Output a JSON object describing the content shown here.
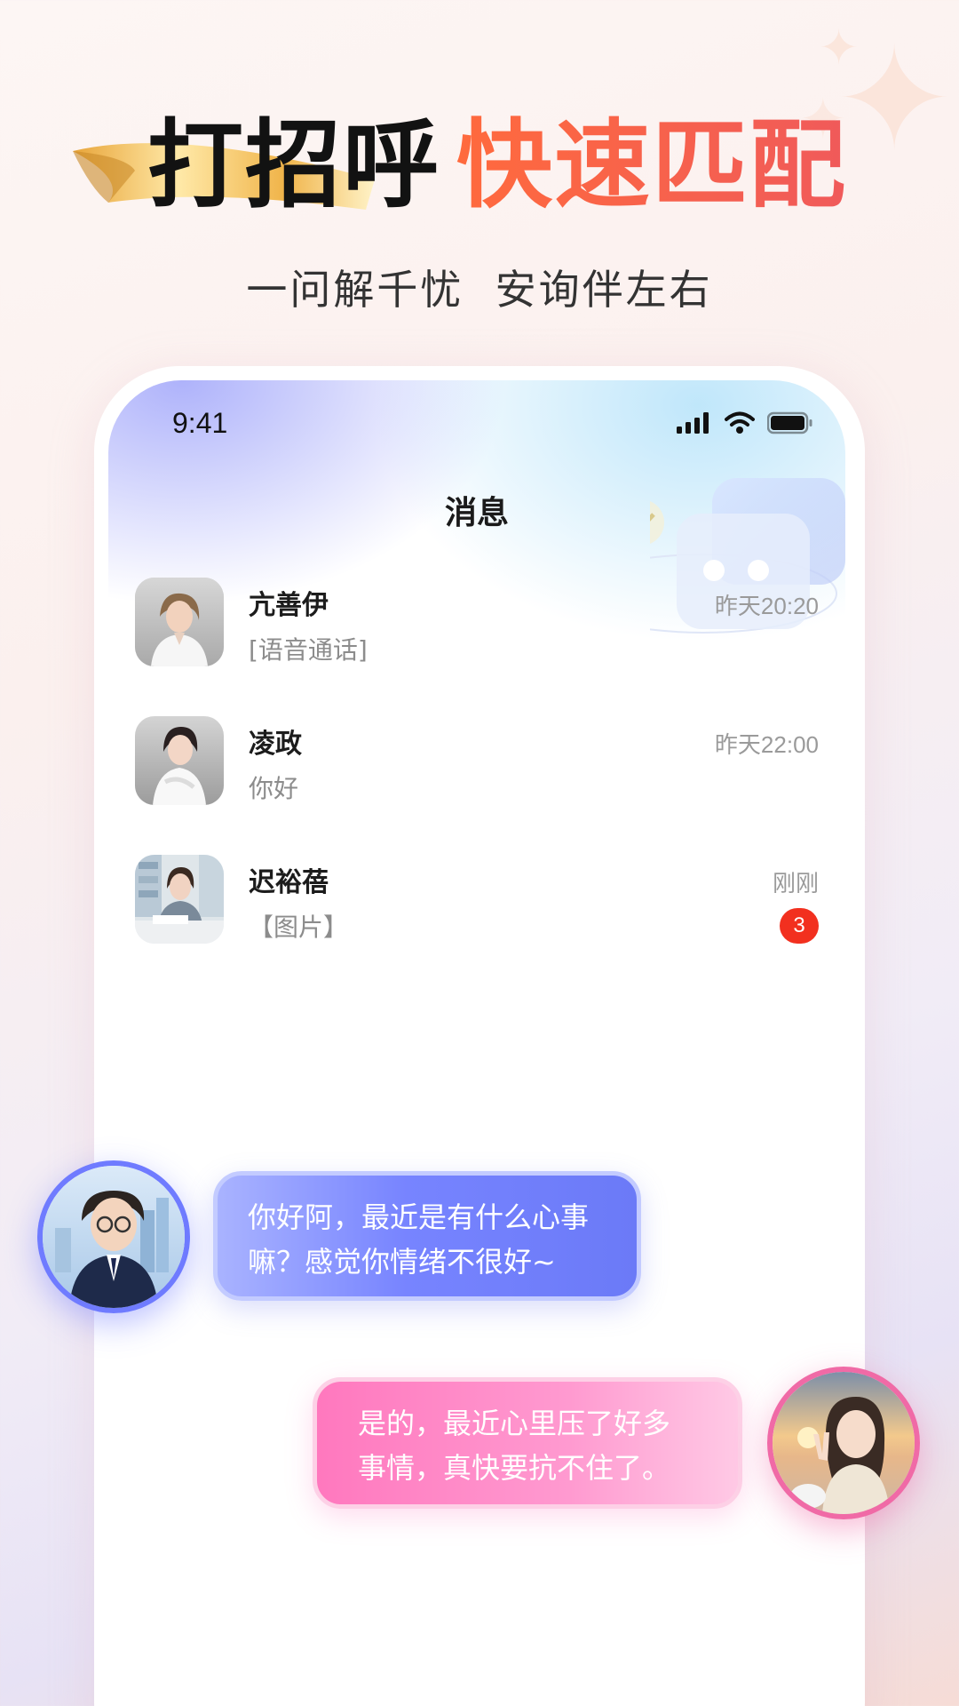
{
  "headline": {
    "part1": "打招呼",
    "part2": "快速匹配"
  },
  "subheadline": "一问解千忧  安询伴左右",
  "status_bar": {
    "time": "9:41"
  },
  "screen": {
    "title": "消息"
  },
  "conversations": [
    {
      "name": "亢善伊",
      "preview": "[语音通话]",
      "time": "昨天20:20"
    },
    {
      "name": "凌政",
      "preview": "你好",
      "time": "昨天22:00"
    },
    {
      "name": "迟裕蓓",
      "preview": "【图片】",
      "time": "刚刚",
      "badge": "3"
    }
  ],
  "chat": {
    "incoming": "你好阿，最近是有什么心事嘛？感觉你情绪不很好~",
    "outgoing": "是的，最近心里压了好多事情，真快要抗不住了。"
  },
  "colors": {
    "accent_orange": "#ff6a3d",
    "bubble_blue": "#6b7af7",
    "bubble_pink": "#ff78be",
    "badge_red": "#f2301f"
  },
  "icons": [
    "sparkle-icon",
    "signal-icon",
    "wifi-icon",
    "battery-icon",
    "chat-bubble-3d-icon"
  ]
}
